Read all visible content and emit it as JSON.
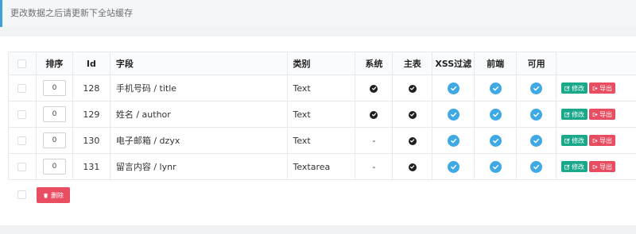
{
  "notice": "更改数据之后请更新下全站缓存",
  "table": {
    "headers": {
      "order": "排序",
      "id": "Id",
      "field": "字段",
      "type": "类别",
      "system": "系统",
      "main": "主表",
      "xss": "XSS过滤",
      "front": "前端",
      "enabled": "可用"
    },
    "rows": [
      {
        "order": "0",
        "id": "128",
        "field": "手机号码 / title",
        "type": "Text",
        "system": "check",
        "main": "check",
        "xss": "check",
        "front": "check",
        "enabled": "check",
        "system_text": ""
      },
      {
        "order": "0",
        "id": "129",
        "field": "姓名 / author",
        "type": "Text",
        "system": "check",
        "main": "check",
        "xss": "check",
        "front": "check",
        "enabled": "check",
        "system_text": ""
      },
      {
        "order": "0",
        "id": "130",
        "field": "电子邮箱 / dzyx",
        "type": "Text",
        "system": "dash",
        "main": "check",
        "xss": "check",
        "front": "check",
        "enabled": "check",
        "system_text": "-"
      },
      {
        "order": "0",
        "id": "131",
        "field": "留言内容 / lynr",
        "type": "Textarea",
        "system": "dash",
        "main": "check",
        "xss": "check",
        "front": "check",
        "enabled": "check",
        "system_text": "-"
      }
    ],
    "edit_label": "修改",
    "export_label": "导出"
  },
  "delete_label": "删除",
  "colors": {
    "accent": "#3fa0d9",
    "edit": "#1aa88a",
    "danger": "#e94d61",
    "check_blue": "#3fa9e6"
  }
}
